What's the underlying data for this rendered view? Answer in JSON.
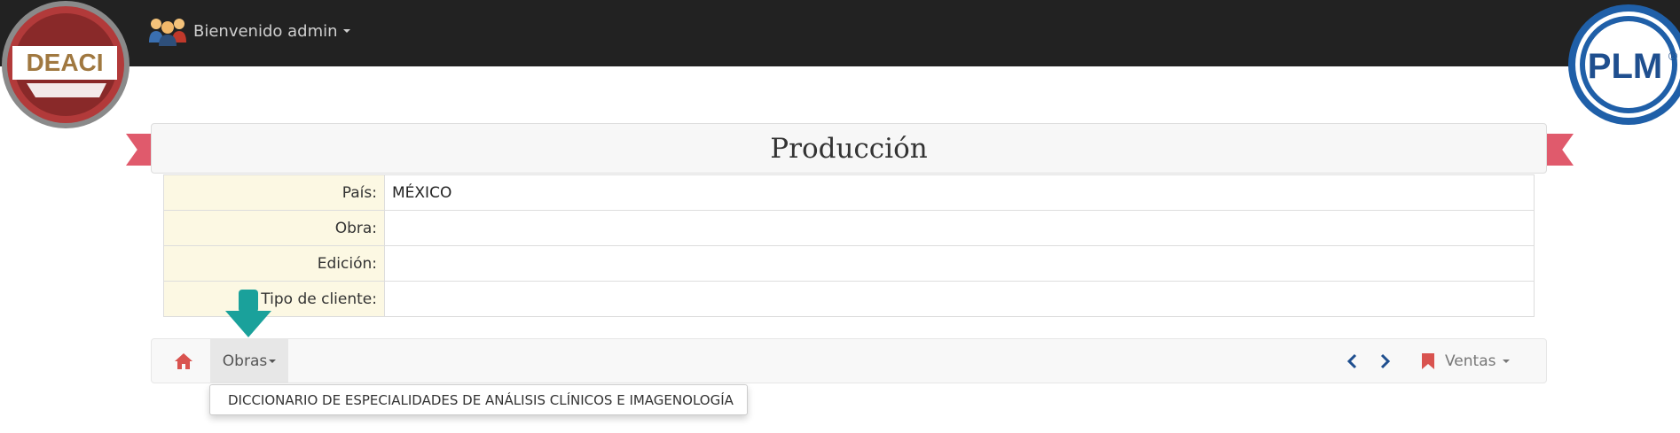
{
  "header": {
    "user_label": "Bienvenido admin",
    "logo_left_text": "DEACI",
    "logo_right_text": "PLM",
    "registered_mark": "®"
  },
  "page_title": "Producción",
  "info_rows": [
    {
      "label": "País:",
      "value": "MÉXICO"
    },
    {
      "label": "Obra:",
      "value": ""
    },
    {
      "label": "Edición:",
      "value": ""
    },
    {
      "label": "Tipo de cliente:",
      "value": ""
    }
  ],
  "subnav": {
    "obras_label": "Obras",
    "ventas_label": "Ventas"
  },
  "dropdown": {
    "items": [
      "DICCIONARIO DE ESPECIALIDADES DE ANÁLISIS CLÍNICOS E IMAGENOLOGÍA"
    ]
  },
  "colors": {
    "navbar": "#222222",
    "ribbon": "#e05a6c",
    "label_bg": "#fcf8e3",
    "accent_red": "#d9534f",
    "accent_teal": "#1aa19b",
    "plm_blue": "#1f5fa8"
  },
  "icons": [
    "users-icon",
    "home-icon",
    "chevron-left-icon",
    "chevron-right-icon",
    "bookmark-icon",
    "arrow-down-icon"
  ]
}
